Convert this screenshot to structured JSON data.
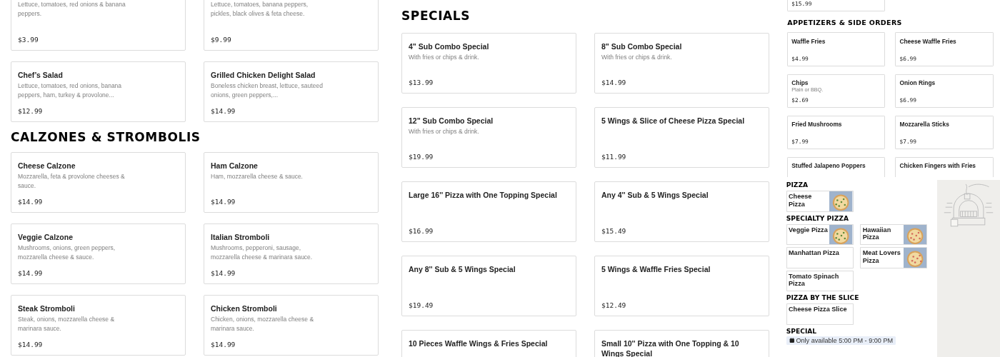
{
  "panels": [
    {
      "kind": "full",
      "sections": [
        {
          "items": [
            {
              "description": "Lettuce, tomatoes, red onions & banana peppers.",
              "price": "$3.99"
            },
            {
              "description": "Lettuce, tomatoes, banana peppers, pickles, black olives & feta cheese.",
              "price": "$9.99"
            },
            {
              "name": "Chef’s Salad",
              "description": "Lettuce, tomatoes, red onions, banana peppers, ham, turkey & provolone...",
              "price": "$12.99"
            },
            {
              "name": "Grilled Chicken Delight Salad",
              "description": "Boneless chicken breast, lettuce, sauteed onions, green peppers,...",
              "price": "$14.99"
            }
          ]
        },
        {
          "heading": "CALZONES & STROMBOLIS",
          "items": [
            {
              "name": "Cheese Calzone",
              "description": "Mozzarella, feta & provolone cheeses & sauce.",
              "price": "$14.99"
            },
            {
              "name": "Ham Calzone",
              "description": "Ham, mozzarella cheese & sauce.",
              "price": "$14.99"
            },
            {
              "name": "Veggie Calzone",
              "description": "Mushrooms, onions, green peppers, mozzarella cheese & sauce.",
              "price": "$14.99"
            },
            {
              "name": "Italian Stromboli",
              "description": "Mushrooms, pepperoni, sausage, mozzarella cheese & marinara sauce.",
              "price": "$14.99"
            },
            {
              "name": "Steak Stromboli",
              "description": "Steak, onions, mozzarella cheese & marinara sauce.",
              "price": "$14.99"
            },
            {
              "name": "Chicken Stromboli",
              "description": "Chicken, onions, mozzarella cheese & marinara sauce.",
              "price": "$14.99"
            }
          ]
        }
      ]
    },
    {
      "kind": "specials",
      "sections": [
        {
          "heading": "SPECIALS",
          "items": [
            {
              "name": "4\" Sub Combo Special",
              "description": "With fries or chips & drink.",
              "price": "$13.99"
            },
            {
              "name": "8\" Sub Combo Special",
              "description": "With fries or chips & drink.",
              "price": "$14.99"
            },
            {
              "name": "12\" Sub Combo Special",
              "description": "With fries or chips & drink.",
              "price": "$19.99"
            },
            {
              "name": "5 Wings & Slice of Cheese Pizza Special",
              "price": "$11.99"
            },
            {
              "name": "Large 16'' Pizza with One Topping Special",
              "price": "$16.99"
            },
            {
              "name": "Any 4'' Sub & 5 Wings Special",
              "price": "$15.49"
            },
            {
              "name": "Any 8'' Sub & 5 Wings Special",
              "price": "$19.49"
            },
            {
              "name": "5 Wings & Waffle Fries Special",
              "price": "$12.49"
            },
            {
              "name": "10 Pieces Waffle Wings & Fries Special"
            },
            {
              "name": "Small 10'' Pizza with One Topping & 10 Wings Special"
            }
          ]
        }
      ]
    },
    {
      "kind": "medium",
      "sections": [
        {
          "items": [
            {
              "price": "$15.99"
            }
          ]
        },
        {
          "heading": "APPETIZERS & SIDE ORDERS",
          "items": [
            {
              "name": "Waffle Fries",
              "price": "$4.99"
            },
            {
              "name": "Cheese Waffle Fries",
              "price": "$6.99"
            },
            {
              "name": "Chips",
              "description": "Plain or BBQ.",
              "price": "$2.69"
            },
            {
              "name": "Onion Rings",
              "price": "$6.99"
            },
            {
              "name": "Fried Mushrooms",
              "price": "$7.99"
            },
            {
              "name": "Mozzarella Sticks",
              "price": "$7.99"
            },
            {
              "name": "Stuffed Jalapeno Poppers"
            },
            {
              "name": "Chicken Fingers with Fries"
            }
          ]
        }
      ]
    },
    {
      "kind": "small",
      "sections": [
        {
          "heading": "PIZZA",
          "items": [
            {
              "name": "Cheese Pizza",
              "image": true
            }
          ]
        },
        {
          "heading": "SPECIALTY PIZZA",
          "items": [
            {
              "name": "Veggie Pizza",
              "image": true
            },
            {
              "name": "Hawaiian Pizza",
              "image": true
            },
            {
              "name": "Manhattan Pizza",
              "image": false
            },
            {
              "name": "Meat Lovers Pizza",
              "image": true
            },
            {
              "name": "Tomato Spinach Pizza",
              "image": false
            }
          ]
        },
        {
          "heading": "PIZZA BY THE SLICE",
          "items": [
            {
              "name": "Cheese Pizza Slice"
            }
          ]
        },
        {
          "heading": "SPECIAL",
          "notice": "Only available 5:00 PM - 9:00 PM"
        }
      ]
    }
  ]
}
